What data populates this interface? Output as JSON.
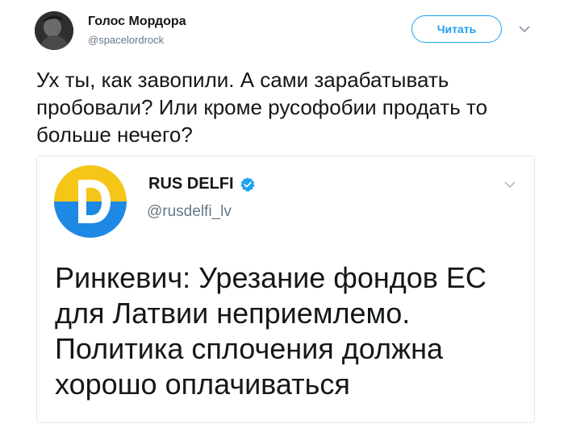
{
  "tweet": {
    "author_name": "Голос Мордора",
    "author_handle": "@spacelordrock",
    "follow_label": "Читать",
    "text": "Ух ты, как завопили. А сами зарабатывать пробовали? Или кроме русофобии продать то больше нечего?"
  },
  "quoted": {
    "author_name": "RUS DELFI",
    "author_handle": "@rusdelfi_lv",
    "logo_letter": "D",
    "text": "Ринкевич: Урезание фондов ЕС для Латвии неприемлемо. Политика сплочения должна хорошо оплачиваться"
  },
  "colors": {
    "accent": "#1da1f2",
    "logo_yellow": "#f5c518",
    "logo_blue": "#1e88e5"
  },
  "icons": [
    "avatar-photo",
    "chevron-down-icon",
    "verified-badge-icon",
    "delfi-logo"
  ]
}
